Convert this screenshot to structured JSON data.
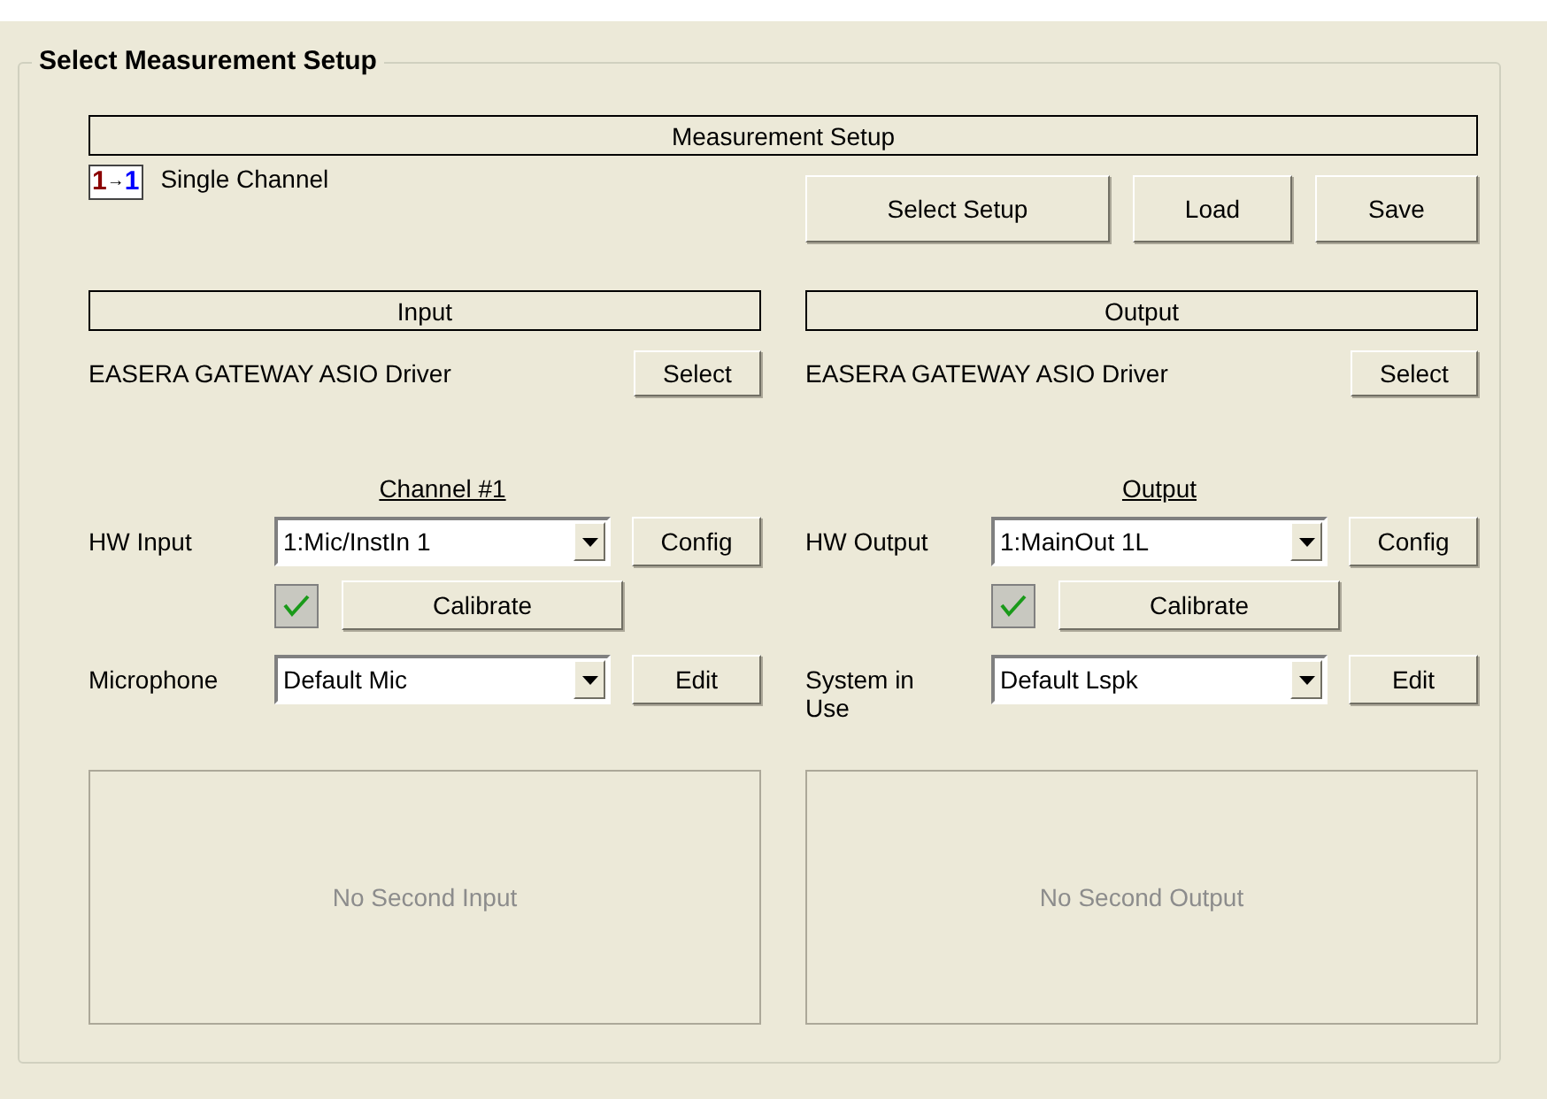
{
  "group": {
    "title": "Select Measurement Setup"
  },
  "setup": {
    "header": "Measurement Setup",
    "mode_icon": "1→1",
    "mode_label": "Single Channel",
    "buttons": [
      "Select Setup",
      "Load",
      "Save"
    ]
  },
  "sides": [
    {
      "header": "Input",
      "driver": "EASERA GATEWAY ASIO Driver",
      "select_button": "Select",
      "channel_title": "Channel #1",
      "rows": [
        {
          "label": "HW Input",
          "value": "1:Mic/InstIn 1",
          "button": "Config"
        },
        {
          "label": "Microphone",
          "value": "Default Mic",
          "button": "Edit"
        }
      ],
      "calibrate": {
        "checked": true,
        "button": "Calibrate"
      },
      "placeholder": "No Second Input"
    },
    {
      "header": "Output",
      "driver": "EASERA GATEWAY ASIO Driver",
      "select_button": "Select",
      "channel_title": "Output",
      "rows": [
        {
          "label": "HW Output",
          "value": "1:MainOut 1L",
          "button": "Config"
        },
        {
          "label": "System in Use",
          "value": "Default Lspk",
          "button": "Edit"
        }
      ],
      "calibrate": {
        "checked": true,
        "button": "Calibrate"
      },
      "placeholder": "No Second Output"
    }
  ]
}
